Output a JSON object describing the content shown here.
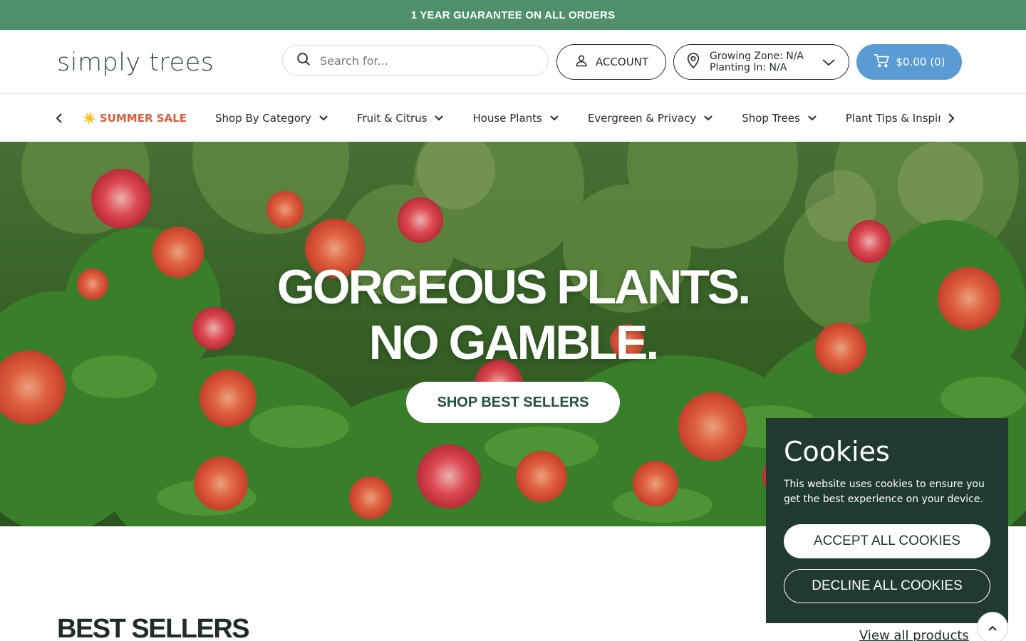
{
  "announcement": {
    "text": "1 YEAR GUARANTEE ON ALL ORDERS"
  },
  "header": {
    "logo_text": "simply trees",
    "search": {
      "placeholder": "Search for..."
    },
    "account_label": "ACCOUNT",
    "zone": {
      "growing_zone": "Growing Zone:  N/A",
      "planting_in": "Planting In:  N/A"
    },
    "cart_label": "$0.00 (0)"
  },
  "nav": {
    "items": [
      {
        "label": "☀️ SUMMER SALE",
        "dropdown": false
      },
      {
        "label": "Shop By Category",
        "dropdown": true
      },
      {
        "label": "Fruit & Citrus",
        "dropdown": true
      },
      {
        "label": "House Plants",
        "dropdown": true
      },
      {
        "label": "Evergreen & Privacy",
        "dropdown": true
      },
      {
        "label": "Shop Trees",
        "dropdown": true
      },
      {
        "label": "Plant Tips & Inspiration",
        "dropdown": false
      }
    ]
  },
  "hero": {
    "title_line1": "GORGEOUS PLANTS.",
    "title_line2": "NO GAMBLE.",
    "cta_label": "SHOP BEST SELLERS"
  },
  "best_sellers": {
    "title": "BEST SELLERS",
    "view_all": "View all products"
  },
  "cookie": {
    "title": "Cookies",
    "text": "This website uses cookies to ensure you get the best experience on your device.",
    "accept_label": "ACCEPT ALL COOKIES",
    "decline_label": "DECLINE ALL COOKIES"
  },
  "colors": {
    "announcement_bg": "#4f8f6a",
    "cart_bg": "#5a9bd3",
    "sale": "#e05a3c",
    "cookie_bg": "#203a31",
    "dark_text": "#1f2d27"
  },
  "icons": {
    "search": "search-icon",
    "account": "user-icon",
    "zone": "location-pin-icon",
    "cart": "cart-icon"
  }
}
